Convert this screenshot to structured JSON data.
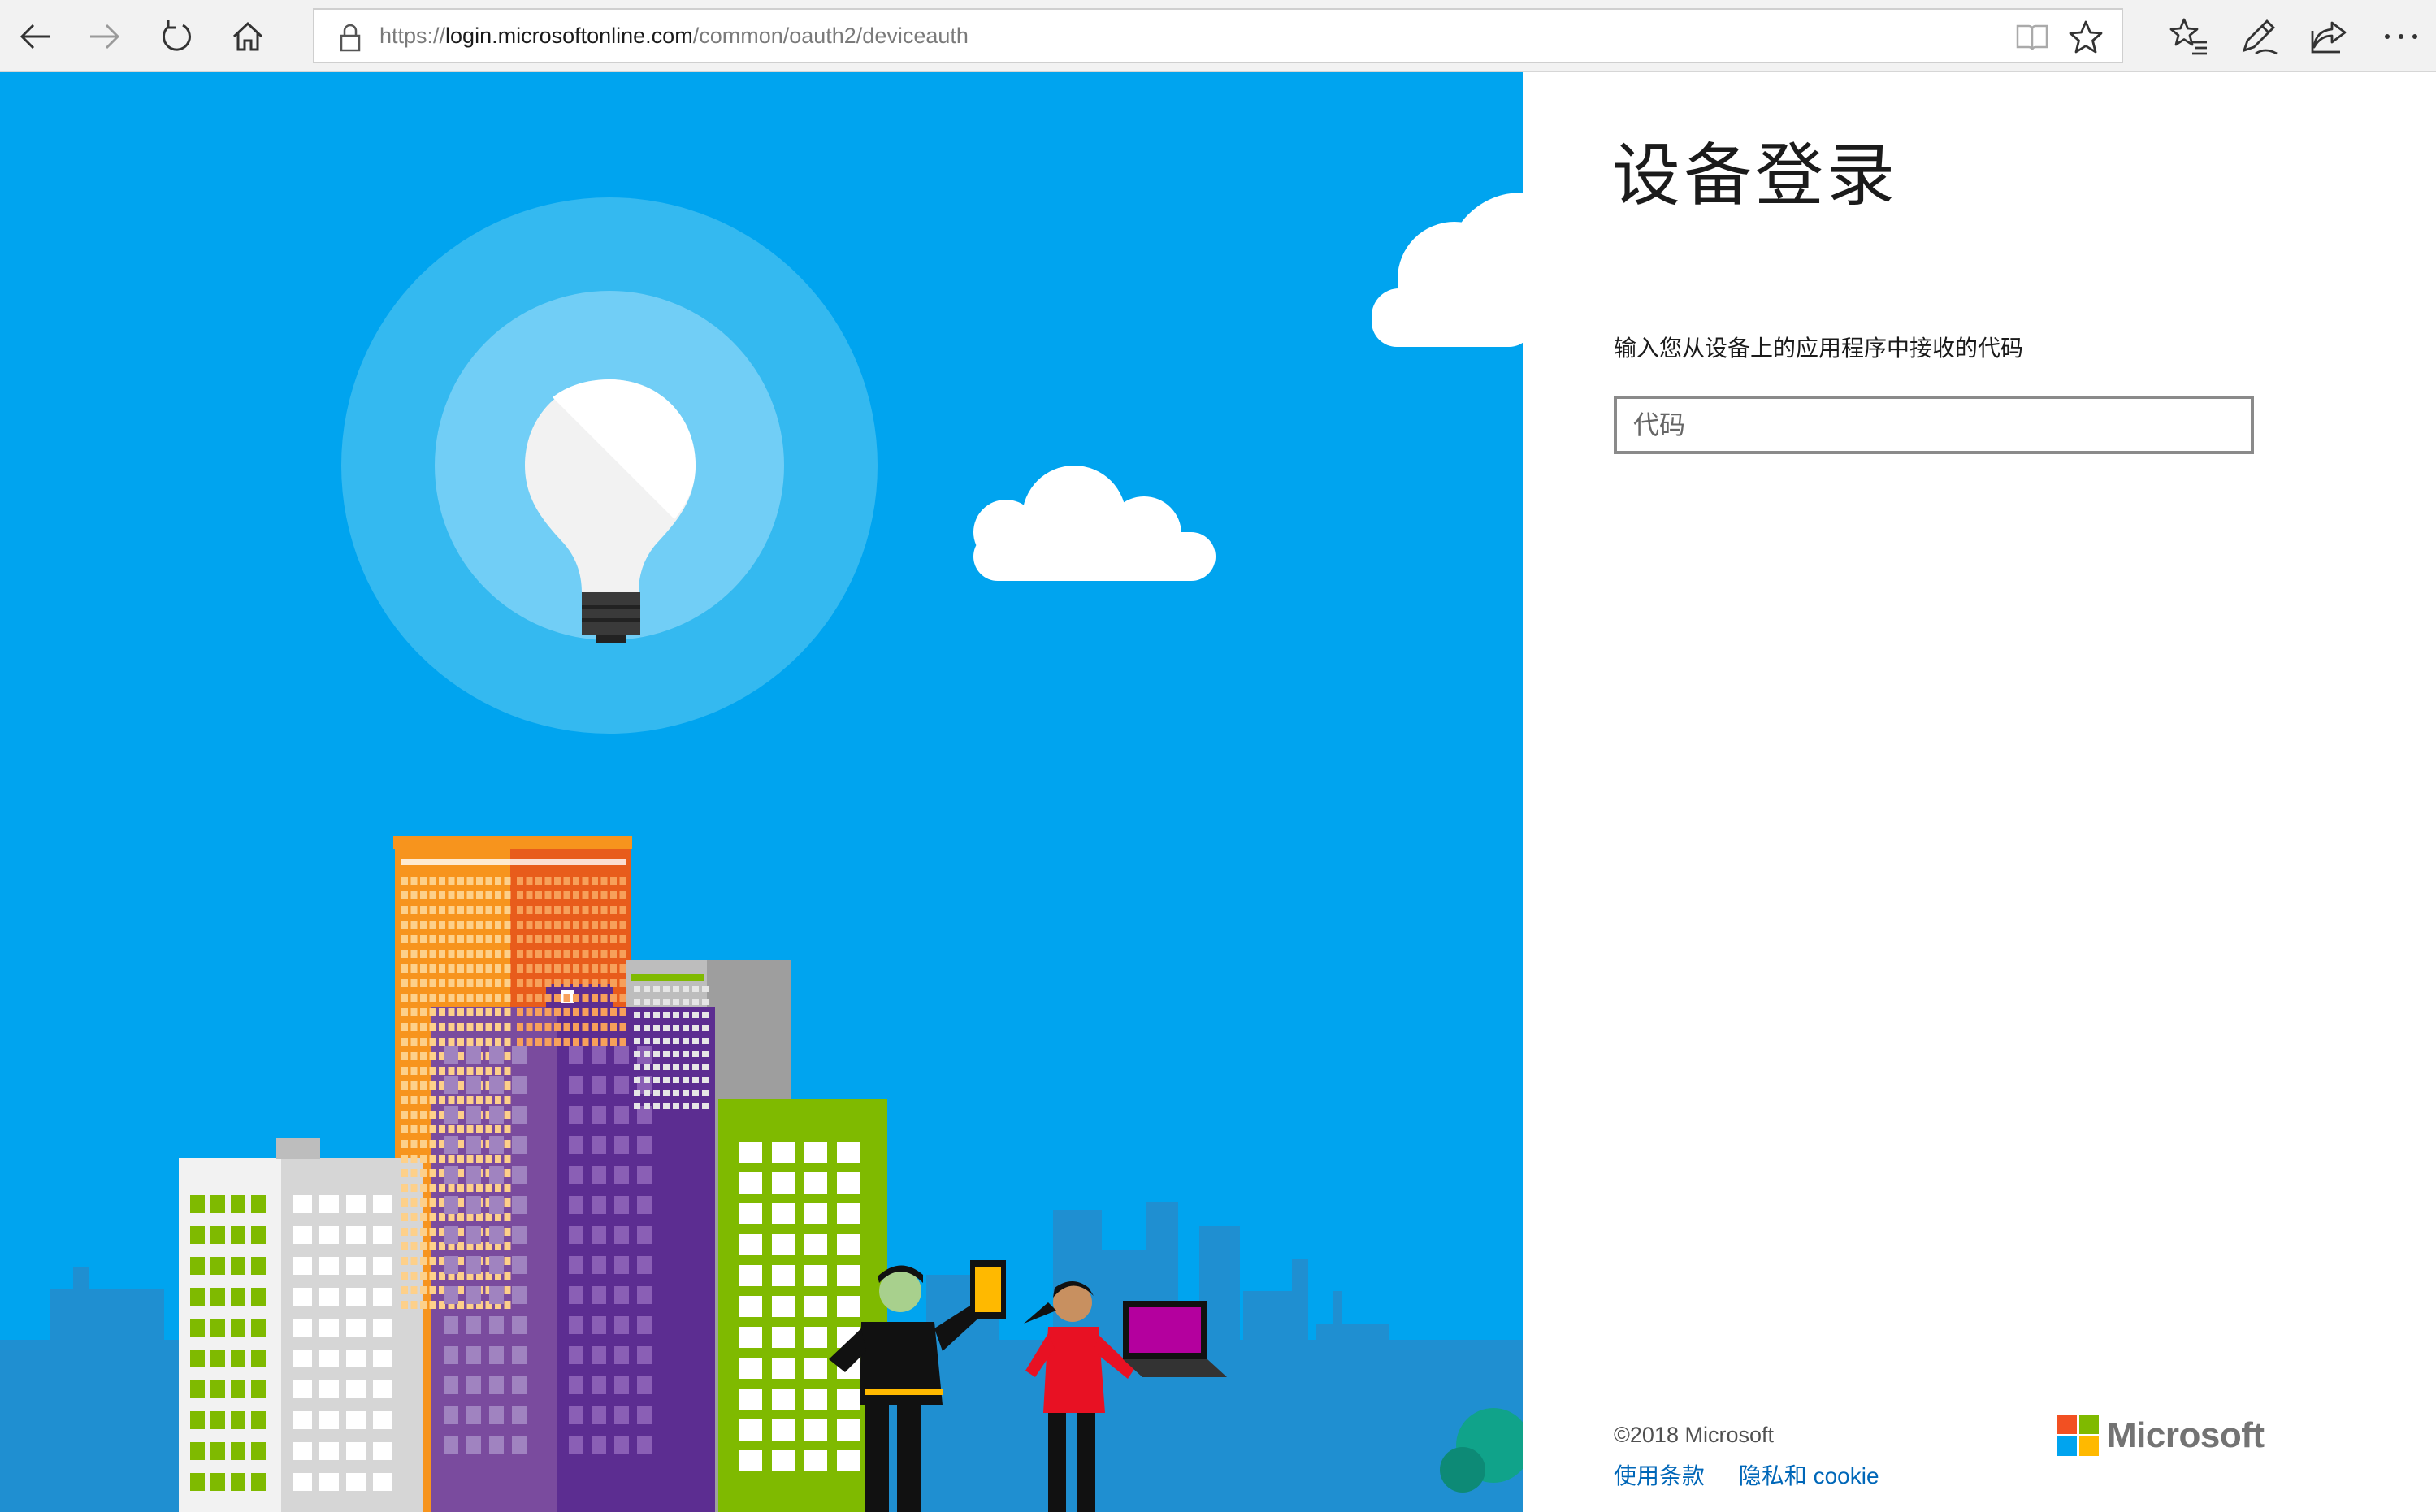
{
  "browser": {
    "url_prefix": "https://",
    "url_host": "login.microsoftonline.com",
    "url_path": "/common/oauth2/deviceauth"
  },
  "signin": {
    "title": "设备登录",
    "description": "输入您从设备上的应用程序中接收的代码",
    "code_placeholder": "代码",
    "code_value": ""
  },
  "footer": {
    "copyright": "©2018 Microsoft",
    "terms_link": "使用条款",
    "privacy_link": "隐私和 cookie",
    "brand": "Microsoft"
  },
  "colors": {
    "hero_background": "#00a4ef",
    "link": "#0067b8",
    "logo_red": "#f25022",
    "logo_green": "#7fba00",
    "logo_blue": "#00a4ef",
    "logo_yellow": "#ffb900"
  },
  "icons": {
    "back": "arrow-left-icon",
    "forward": "arrow-right-icon",
    "refresh": "refresh-icon",
    "home": "home-icon",
    "lock": "lock-icon",
    "reading_view": "book-icon",
    "favorite": "star-icon",
    "favorites_hub": "star-list-icon",
    "notes": "pen-icon",
    "share": "share-icon",
    "more": "ellipsis-icon"
  }
}
